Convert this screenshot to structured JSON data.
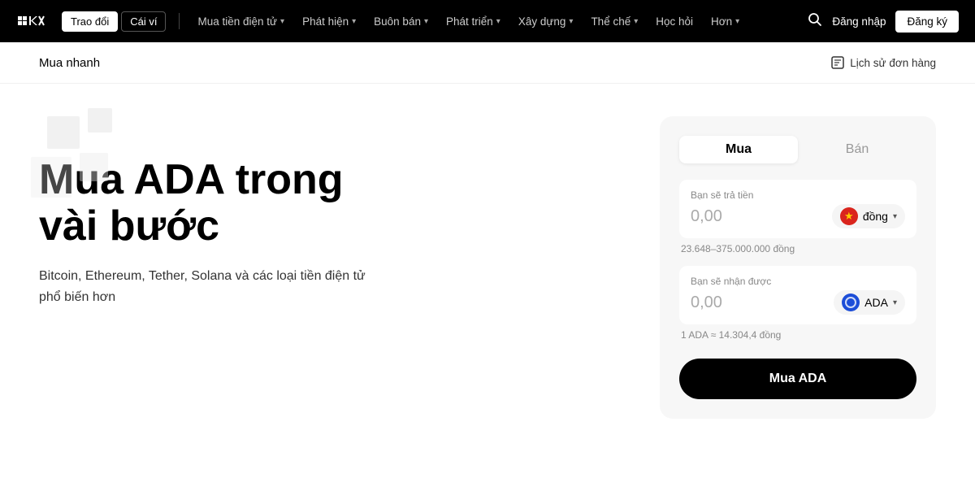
{
  "navbar": {
    "logo_alt": "OKX Logo",
    "btn_exchange": "Trao đổi",
    "btn_wallet": "Cái ví",
    "menu_items": [
      {
        "label": "Mua tiền điện tử",
        "has_chevron": true
      },
      {
        "label": "Phát hiện",
        "has_chevron": true
      },
      {
        "label": "Buôn bán",
        "has_chevron": true
      },
      {
        "label": "Phát triển",
        "has_chevron": true
      },
      {
        "label": "Xây dựng",
        "has_chevron": true
      },
      {
        "label": "Thể chế",
        "has_chevron": true
      },
      {
        "label": "Học hỏi",
        "has_chevron": false
      },
      {
        "label": "Hơn",
        "has_chevron": true
      }
    ],
    "login_label": "Đăng nhập",
    "register_label": "Đăng ký"
  },
  "subheader": {
    "title": "Mua nhanh",
    "order_history": "Lịch sử đơn hàng"
  },
  "hero": {
    "title_line1": "Mua ADA trong",
    "title_line2": "vài bước",
    "subtitle": "Bitcoin, Ethereum, Tether, Solana và các loại tiền điện tử phổ biến hơn"
  },
  "card": {
    "tab_buy": "Mua",
    "tab_sell": "Bán",
    "pay_label": "Bạn sẽ trả tiền",
    "pay_value": "0,00",
    "pay_currency": "đồng",
    "pay_hint": "23.648–375.000.000 đồng",
    "receive_label": "Bạn sẽ nhận được",
    "receive_value": "0,00",
    "receive_currency": "ADA",
    "receive_hint": "1 ADA ≈ 14.304,4 đồng",
    "buy_button": "Mua ADA"
  }
}
